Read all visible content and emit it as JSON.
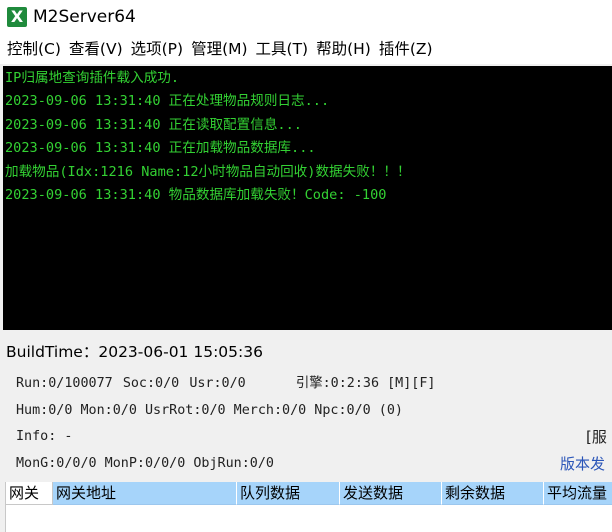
{
  "window": {
    "title": "M2Server64",
    "icon": "X"
  },
  "menu": [
    "控制(C)",
    "查看(V)",
    "选项(P)",
    "管理(M)",
    "工具(T)",
    "帮助(H)",
    "插件(Z)"
  ],
  "log": [
    "IP归属地查询插件载入成功.",
    "2023-09-06 13:31:40 正在处理物品规则日志...",
    "2023-09-06 13:31:40 正在读取配置信息...",
    "2023-09-06 13:31:40 正在加载物品数据库...",
    "加载物品(Idx:1216 Name:12小时物品自动回收)数据失败！！！",
    "2023-09-06 13:31:40 物品数据库加载失败！Code: -100"
  ],
  "build": {
    "label": "BuildTime：",
    "value": "2023-06-01 15:05:36"
  },
  "stats": {
    "run": "Run:0/100077",
    "soc": "Soc:0/0",
    "usr": "Usr:0/0",
    "engine": "引擎:0:2:36 [M][F]",
    "hum": "Hum:0/0 Mon:0/0 UsrRot:0/0 Merch:0/0 Npc:0/0 (0)",
    "info": "Info: -",
    "info_right": "[服",
    "mon": "MonG:0/0/0 MonP:0/0/0 ObjRun:0/0",
    "version_link": "版本发"
  },
  "grid": {
    "columns": [
      "网关",
      "网关地址",
      "队列数据",
      "发送数据",
      "剩余数据",
      "平均流量"
    ]
  },
  "colors": {
    "log_text": "#33d133",
    "log_bg": "#000000",
    "header_bg": "#a6d4fa",
    "link": "#2a55b8"
  }
}
